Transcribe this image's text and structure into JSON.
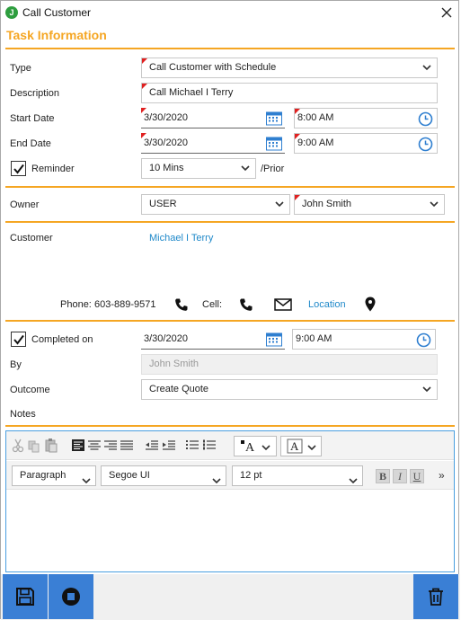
{
  "window": {
    "title": "Call Customer",
    "logo_letter": "J"
  },
  "section_title": "Task Information",
  "task": {
    "type_label": "Type",
    "type_value": "Call Customer with Schedule",
    "description_label": "Description",
    "description_value": "Call Michael I Terry",
    "start_label": "Start Date",
    "start_date": "3/30/2020",
    "start_time": "8:00 AM",
    "end_label": "End Date",
    "end_date": "3/30/2020",
    "end_time": "9:00 AM",
    "reminder_label": "Reminder",
    "reminder_checked": true,
    "reminder_value": "10 Mins",
    "reminder_suffix": "/Prior"
  },
  "owner": {
    "label": "Owner",
    "type_value": "USER",
    "name_value": "John Smith"
  },
  "customer": {
    "label": "Customer",
    "name": "Michael I Terry",
    "phone_label": "Phone:",
    "phone_value": "603-889-9571",
    "cell_label": "Cell:",
    "location_label": "Location"
  },
  "completion": {
    "completed_label": "Completed on",
    "completed_checked": true,
    "completed_date": "3/30/2020",
    "completed_time": "9:00 AM",
    "by_label": "By",
    "by_value": "John Smith",
    "outcome_label": "Outcome",
    "outcome_value": "Create Quote",
    "notes_label": "Notes"
  },
  "editor": {
    "paragraph_style": "Paragraph",
    "font": "Segoe UI",
    "size": "12 pt",
    "bold": "B",
    "italic": "I",
    "underline": "U",
    "more": "»"
  },
  "colors": {
    "accent": "#f5a623",
    "link": "#1e88c9",
    "button": "#3a7fd5",
    "required": "#e02020"
  },
  "icons": [
    "close-icon",
    "calendar-icon",
    "clock-icon",
    "phone-icon",
    "mail-icon",
    "location-pin-icon",
    "save-icon",
    "stop-icon",
    "trash-icon"
  ]
}
